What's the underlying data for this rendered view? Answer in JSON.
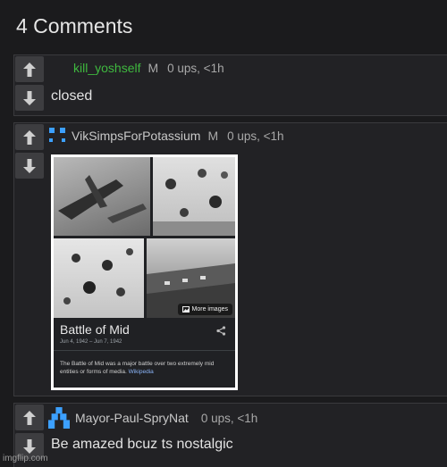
{
  "heading": "4 Comments",
  "comments": [
    {
      "username": "kill_yoshself",
      "username_color": "#3fb83f",
      "mod": "M",
      "meta": "0 ups, <1h",
      "text": "closed"
    },
    {
      "username": "VikSimpsForPotassium",
      "username_color": "#c8c8c8",
      "mod": "M",
      "meta": "0 ups, <1h",
      "image": {
        "title": "Battle of Mid",
        "dates": "Jun 4, 1942 – Jun 7, 1942",
        "more_images": "More images",
        "description": "The Battle of Mid was a major battle over two extremely mid entities or forms of media.",
        "source_link": "Wikipedia"
      }
    },
    {
      "username": "Mayor-Paul-SpryNat",
      "username_color": "#c8c8c8",
      "meta": "0 ups, <1h",
      "text": "Be amazed bcuz ts nostalgic"
    }
  ],
  "watermark": "imgflip.com",
  "colors": {
    "background": "#1b1b1d",
    "card": "#222225",
    "vote_button": "#3d3d40",
    "avatar_blue": "#3ca0ff"
  }
}
